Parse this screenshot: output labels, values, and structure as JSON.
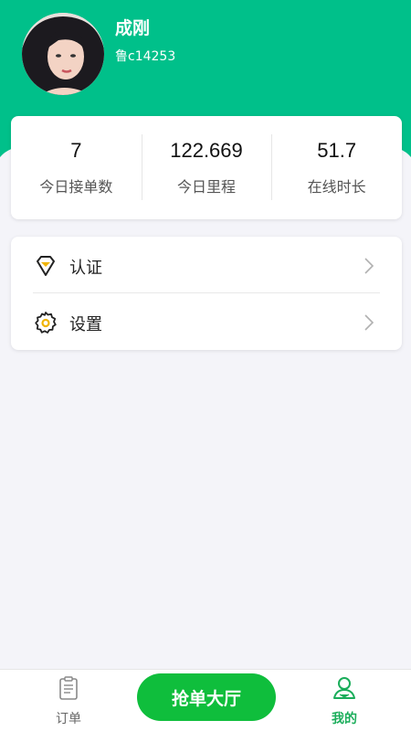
{
  "profile": {
    "name": "成刚",
    "plate": "鲁c14253",
    "avatar_icon": "user-photo"
  },
  "stats": [
    {
      "value": "7",
      "label": "今日接单数"
    },
    {
      "value": "122.669",
      "label": "今日里程"
    },
    {
      "value": "51.7",
      "label": "在线时长"
    }
  ],
  "menu": [
    {
      "label": "认证",
      "icon": "certification-diamond-icon"
    },
    {
      "label": "设置",
      "icon": "gear-icon"
    }
  ],
  "tabbar": {
    "orders_label": "订单",
    "grab_label": "抢单大厅",
    "mine_label": "我的",
    "active": "我的"
  },
  "colors": {
    "brand_green": "#00c08a",
    "button_green": "#0fbe3c",
    "active_tab": "#1aad5a",
    "background": "#f4f4f9"
  }
}
